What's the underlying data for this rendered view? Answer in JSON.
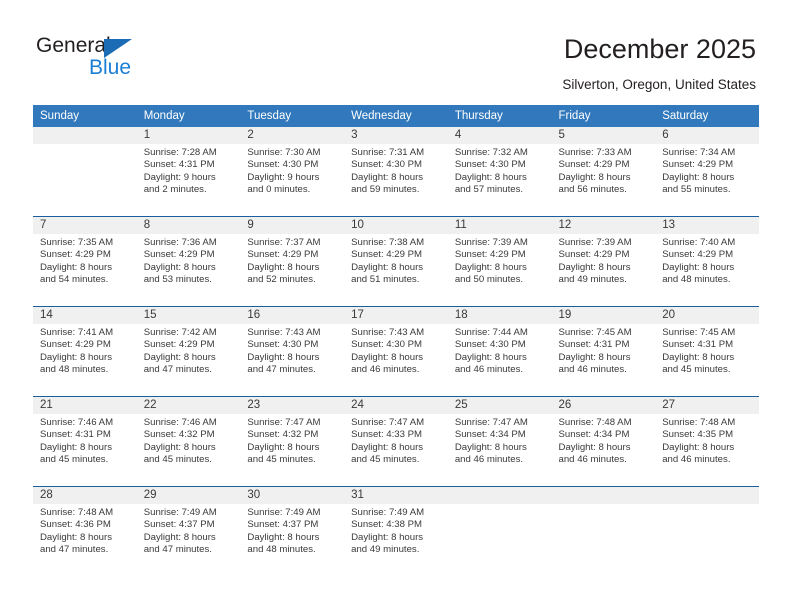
{
  "brand": {
    "name_part1": "General",
    "name_part2": "Blue",
    "triangle_color": "#1b6cb5",
    "blue_color": "#1b7fd4"
  },
  "header": {
    "title": "December 2025",
    "subtitle": "Silverton, Oregon, United States"
  },
  "calendar": {
    "header_bg": "#3179bc",
    "header_text_color": "#ffffff",
    "daynum_bg": "#f0f0f0",
    "row_divider_color": "#1b5e9e",
    "weekday_headers": [
      "Sunday",
      "Monday",
      "Tuesday",
      "Wednesday",
      "Thursday",
      "Friday",
      "Saturday"
    ],
    "weeks": [
      [
        {
          "day": "",
          "line1": "",
          "line2": "",
          "line3": "",
          "line4": ""
        },
        {
          "day": "1",
          "line1": "Sunrise: 7:28 AM",
          "line2": "Sunset: 4:31 PM",
          "line3": "Daylight: 9 hours",
          "line4": "and 2 minutes."
        },
        {
          "day": "2",
          "line1": "Sunrise: 7:30 AM",
          "line2": "Sunset: 4:30 PM",
          "line3": "Daylight: 9 hours",
          "line4": "and 0 minutes."
        },
        {
          "day": "3",
          "line1": "Sunrise: 7:31 AM",
          "line2": "Sunset: 4:30 PM",
          "line3": "Daylight: 8 hours",
          "line4": "and 59 minutes."
        },
        {
          "day": "4",
          "line1": "Sunrise: 7:32 AM",
          "line2": "Sunset: 4:30 PM",
          "line3": "Daylight: 8 hours",
          "line4": "and 57 minutes."
        },
        {
          "day": "5",
          "line1": "Sunrise: 7:33 AM",
          "line2": "Sunset: 4:29 PM",
          "line3": "Daylight: 8 hours",
          "line4": "and 56 minutes."
        },
        {
          "day": "6",
          "line1": "Sunrise: 7:34 AM",
          "line2": "Sunset: 4:29 PM",
          "line3": "Daylight: 8 hours",
          "line4": "and 55 minutes."
        }
      ],
      [
        {
          "day": "7",
          "line1": "Sunrise: 7:35 AM",
          "line2": "Sunset: 4:29 PM",
          "line3": "Daylight: 8 hours",
          "line4": "and 54 minutes."
        },
        {
          "day": "8",
          "line1": "Sunrise: 7:36 AM",
          "line2": "Sunset: 4:29 PM",
          "line3": "Daylight: 8 hours",
          "line4": "and 53 minutes."
        },
        {
          "day": "9",
          "line1": "Sunrise: 7:37 AM",
          "line2": "Sunset: 4:29 PM",
          "line3": "Daylight: 8 hours",
          "line4": "and 52 minutes."
        },
        {
          "day": "10",
          "line1": "Sunrise: 7:38 AM",
          "line2": "Sunset: 4:29 PM",
          "line3": "Daylight: 8 hours",
          "line4": "and 51 minutes."
        },
        {
          "day": "11",
          "line1": "Sunrise: 7:39 AM",
          "line2": "Sunset: 4:29 PM",
          "line3": "Daylight: 8 hours",
          "line4": "and 50 minutes."
        },
        {
          "day": "12",
          "line1": "Sunrise: 7:39 AM",
          "line2": "Sunset: 4:29 PM",
          "line3": "Daylight: 8 hours",
          "line4": "and 49 minutes."
        },
        {
          "day": "13",
          "line1": "Sunrise: 7:40 AM",
          "line2": "Sunset: 4:29 PM",
          "line3": "Daylight: 8 hours",
          "line4": "and 48 minutes."
        }
      ],
      [
        {
          "day": "14",
          "line1": "Sunrise: 7:41 AM",
          "line2": "Sunset: 4:29 PM",
          "line3": "Daylight: 8 hours",
          "line4": "and 48 minutes."
        },
        {
          "day": "15",
          "line1": "Sunrise: 7:42 AM",
          "line2": "Sunset: 4:29 PM",
          "line3": "Daylight: 8 hours",
          "line4": "and 47 minutes."
        },
        {
          "day": "16",
          "line1": "Sunrise: 7:43 AM",
          "line2": "Sunset: 4:30 PM",
          "line3": "Daylight: 8 hours",
          "line4": "and 47 minutes."
        },
        {
          "day": "17",
          "line1": "Sunrise: 7:43 AM",
          "line2": "Sunset: 4:30 PM",
          "line3": "Daylight: 8 hours",
          "line4": "and 46 minutes."
        },
        {
          "day": "18",
          "line1": "Sunrise: 7:44 AM",
          "line2": "Sunset: 4:30 PM",
          "line3": "Daylight: 8 hours",
          "line4": "and 46 minutes."
        },
        {
          "day": "19",
          "line1": "Sunrise: 7:45 AM",
          "line2": "Sunset: 4:31 PM",
          "line3": "Daylight: 8 hours",
          "line4": "and 46 minutes."
        },
        {
          "day": "20",
          "line1": "Sunrise: 7:45 AM",
          "line2": "Sunset: 4:31 PM",
          "line3": "Daylight: 8 hours",
          "line4": "and 45 minutes."
        }
      ],
      [
        {
          "day": "21",
          "line1": "Sunrise: 7:46 AM",
          "line2": "Sunset: 4:31 PM",
          "line3": "Daylight: 8 hours",
          "line4": "and 45 minutes."
        },
        {
          "day": "22",
          "line1": "Sunrise: 7:46 AM",
          "line2": "Sunset: 4:32 PM",
          "line3": "Daylight: 8 hours",
          "line4": "and 45 minutes."
        },
        {
          "day": "23",
          "line1": "Sunrise: 7:47 AM",
          "line2": "Sunset: 4:32 PM",
          "line3": "Daylight: 8 hours",
          "line4": "and 45 minutes."
        },
        {
          "day": "24",
          "line1": "Sunrise: 7:47 AM",
          "line2": "Sunset: 4:33 PM",
          "line3": "Daylight: 8 hours",
          "line4": "and 45 minutes."
        },
        {
          "day": "25",
          "line1": "Sunrise: 7:47 AM",
          "line2": "Sunset: 4:34 PM",
          "line3": "Daylight: 8 hours",
          "line4": "and 46 minutes."
        },
        {
          "day": "26",
          "line1": "Sunrise: 7:48 AM",
          "line2": "Sunset: 4:34 PM",
          "line3": "Daylight: 8 hours",
          "line4": "and 46 minutes."
        },
        {
          "day": "27",
          "line1": "Sunrise: 7:48 AM",
          "line2": "Sunset: 4:35 PM",
          "line3": "Daylight: 8 hours",
          "line4": "and 46 minutes."
        }
      ],
      [
        {
          "day": "28",
          "line1": "Sunrise: 7:48 AM",
          "line2": "Sunset: 4:36 PM",
          "line3": "Daylight: 8 hours",
          "line4": "and 47 minutes."
        },
        {
          "day": "29",
          "line1": "Sunrise: 7:49 AM",
          "line2": "Sunset: 4:37 PM",
          "line3": "Daylight: 8 hours",
          "line4": "and 47 minutes."
        },
        {
          "day": "30",
          "line1": "Sunrise: 7:49 AM",
          "line2": "Sunset: 4:37 PM",
          "line3": "Daylight: 8 hours",
          "line4": "and 48 minutes."
        },
        {
          "day": "31",
          "line1": "Sunrise: 7:49 AM",
          "line2": "Sunset: 4:38 PM",
          "line3": "Daylight: 8 hours",
          "line4": "and 49 minutes."
        },
        {
          "day": "",
          "line1": "",
          "line2": "",
          "line3": "",
          "line4": ""
        },
        {
          "day": "",
          "line1": "",
          "line2": "",
          "line3": "",
          "line4": ""
        },
        {
          "day": "",
          "line1": "",
          "line2": "",
          "line3": "",
          "line4": ""
        }
      ]
    ]
  }
}
